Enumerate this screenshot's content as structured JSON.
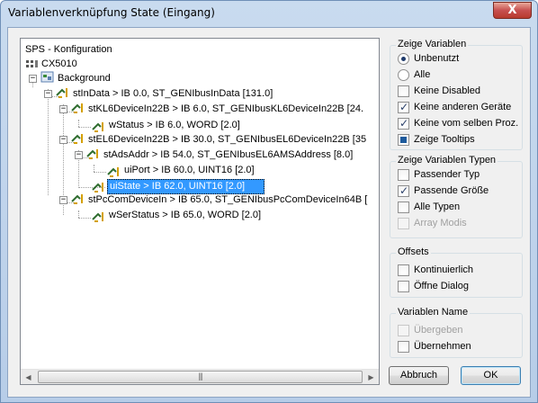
{
  "window": {
    "title": "Variablenverknüpfung State (Eingang)",
    "close_label": "X"
  },
  "tree": {
    "nodes": [
      {
        "label": "SPS - Konfiguration"
      },
      {
        "label": "CX5010"
      },
      {
        "label": "Background"
      },
      {
        "label": "stInData   >   IB 0.0, ST_GENIbusInData [131.0]"
      },
      {
        "label": "stKL6DeviceIn22B   >   IB 6.0, ST_GENIbusKL6DeviceIn22B [24."
      },
      {
        "label": "wStatus   >   IB 6.0, WORD [2.0]"
      },
      {
        "label": "stEL6DeviceIn22B   >   IB 30.0, ST_GENIbusEL6DeviceIn22B [35"
      },
      {
        "label": "stAdsAddr   >   IB 54.0, ST_GENIbusEL6AMSAddress [8.0]"
      },
      {
        "label": "uiPort   >   IB 60.0, UINT16 [2.0]"
      },
      {
        "label": "uiState   >   IB 62.0, UINT16 [2.0]"
      },
      {
        "label": "stPcComDeviceIn   >   IB 65.0, ST_GENIbusPcComDeviceIn64B ["
      },
      {
        "label": "wSerStatus   >   IB 65.0, WORD [2.0]"
      }
    ]
  },
  "groups": {
    "show_vars": {
      "title": "Zeige Variablen",
      "unused": "Unbenutzt",
      "all": "Alle",
      "no_disabled": "Keine Disabled",
      "no_other_devices": "Keine anderen Geräte",
      "no_same_proc": "Keine vom selben Proz.",
      "show_tooltips": "Zeige Tooltips"
    },
    "show_types": {
      "title": "Zeige Variablen Typen",
      "matching_type": "Passender Typ",
      "matching_size": "Passende Größe",
      "all_types": "Alle Typen",
      "array_modes": "Array Modis"
    },
    "offsets": {
      "title": "Offsets",
      "continuous": "Kontinuierlich",
      "open_dialog": "Öffne Dialog"
    },
    "var_name": {
      "title": "Variablen Name",
      "transfer": "Übergeben",
      "take_over": "Übernehmen"
    }
  },
  "buttons": {
    "cancel": "Abbruch",
    "ok": "OK"
  },
  "colors": {
    "selection": "#3399ff",
    "title_gradient_top": "#c9dbef",
    "close_red": "#c75050"
  }
}
